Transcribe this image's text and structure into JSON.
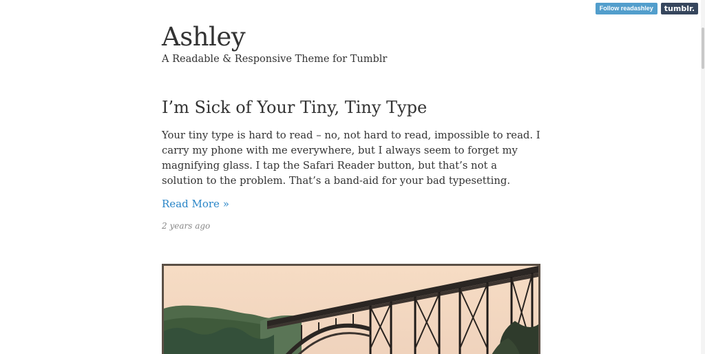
{
  "tumblr_bar": {
    "follow_label": "Follow readashley",
    "logo_text": "tumblr."
  },
  "blog": {
    "title": "Ashley",
    "subtitle": "A Readable & Responsive Theme for Tumblr"
  },
  "post": {
    "title": "I’m Sick of Your Tiny, Tiny Type",
    "body": "Your tiny type is hard to read – no, not hard to read, impossible to read. I carry my phone with me everywhere, but I always seem to forget my magnifying glass. I tap the Safari Reader button, but that’s not a solution to the problem. That’s a band-aid for your bad typesetting.",
    "read_more": "Read More »",
    "date": "2 years ago"
  },
  "colors": {
    "link": "#2a86c8",
    "follow_button": "#529ecc",
    "tumblr_logo": "#36465d",
    "text": "#333333",
    "meta": "#888888"
  }
}
